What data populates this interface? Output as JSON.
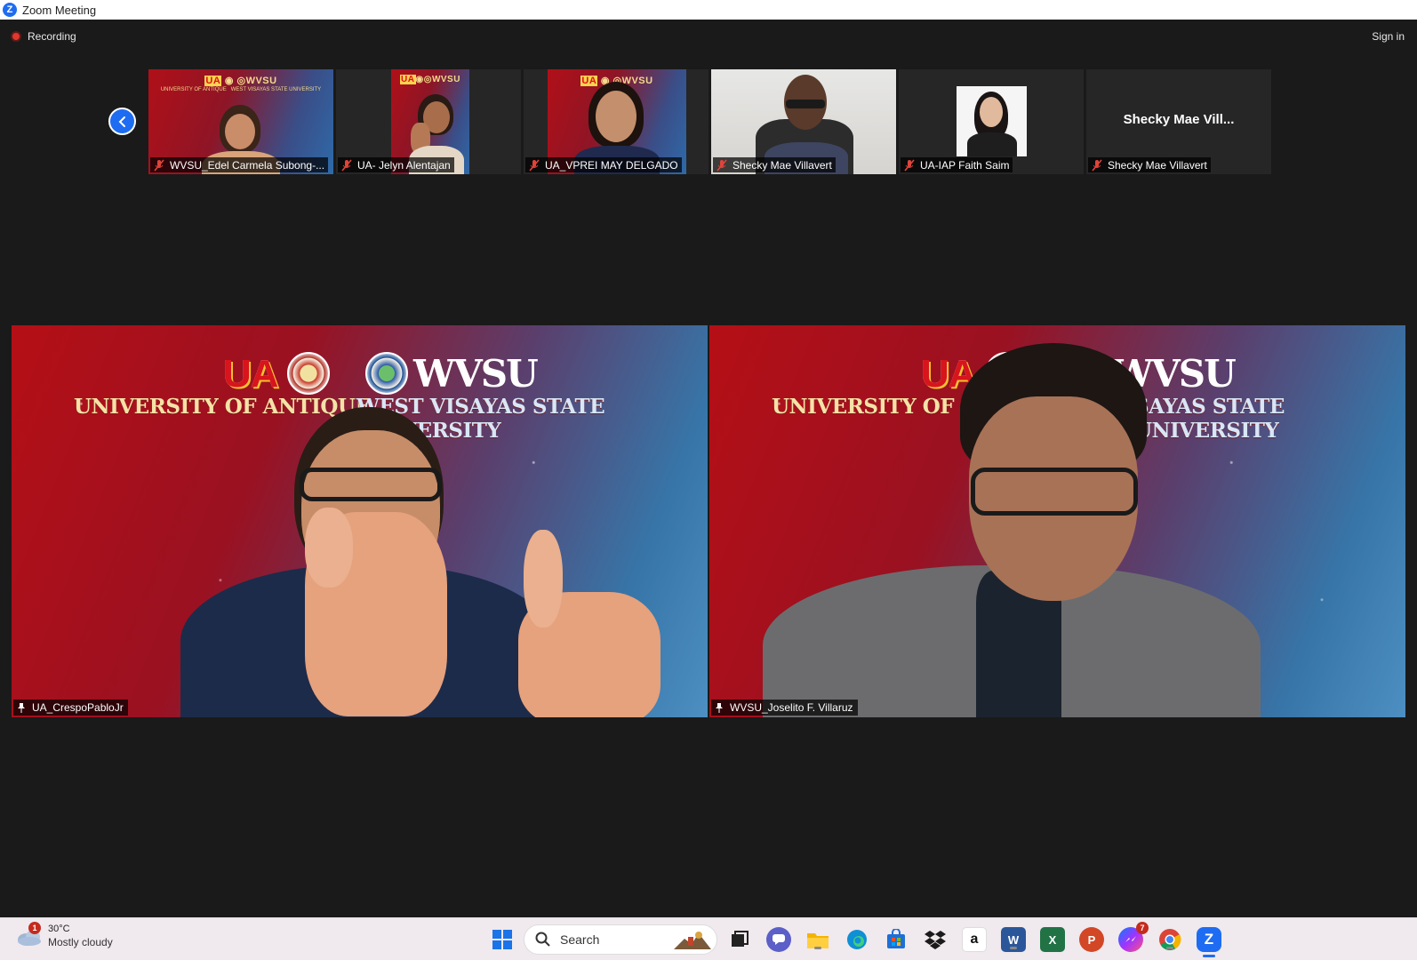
{
  "window": {
    "title": "Zoom Meeting"
  },
  "meeting": {
    "recording_label": "Recording",
    "signin_label": "Sign in"
  },
  "gallery": {
    "tiles": [
      {
        "name": "WVSU_Edel Carmela Subong-..."
      },
      {
        "name": "UA- Jelyn Alentajan"
      },
      {
        "name": "UA_VPREI MAY DELGADO"
      },
      {
        "name": "Shecky Mae Villavert"
      },
      {
        "name": "UA-IAP Faith Saim"
      },
      {
        "name": "Shecky Mae Villavert",
        "placeholder_name": "Shecky  Mae  Vill..."
      }
    ]
  },
  "branding": {
    "ua_logo": "UA",
    "ua_name": "UNIVERSITY OF ANTIQUE",
    "wvsu_logo": "WVSU",
    "wvsu_name": "WEST VISAYAS STATE UNIVERSITY",
    "ua_name_partial": "UNIVERSITY OF ANT",
    "wvsu_name_partial": "SAYAS STATE UNIVERSITY"
  },
  "speakers": [
    {
      "name": "UA_CrespoPabloJr"
    },
    {
      "name": "WVSU_Joselito F. Villaruz"
    }
  ],
  "taskbar": {
    "weather_temp": "30°C",
    "weather_desc": "Mostly cloudy",
    "weather_badge": "1",
    "search_placeholder": "Search",
    "messenger_badge": "7",
    "icons": [
      "windows-start",
      "search",
      "task-view",
      "teams-chat",
      "file-explorer",
      "edge",
      "microsoft-store",
      "dropbox",
      "amazon",
      "word",
      "excel",
      "powerpoint",
      "messenger",
      "chrome",
      "zoom"
    ]
  },
  "colors": {
    "zoom_blue": "#1e6cf2",
    "recording_red": "#e2372e",
    "muted_red": "#e0443a"
  }
}
